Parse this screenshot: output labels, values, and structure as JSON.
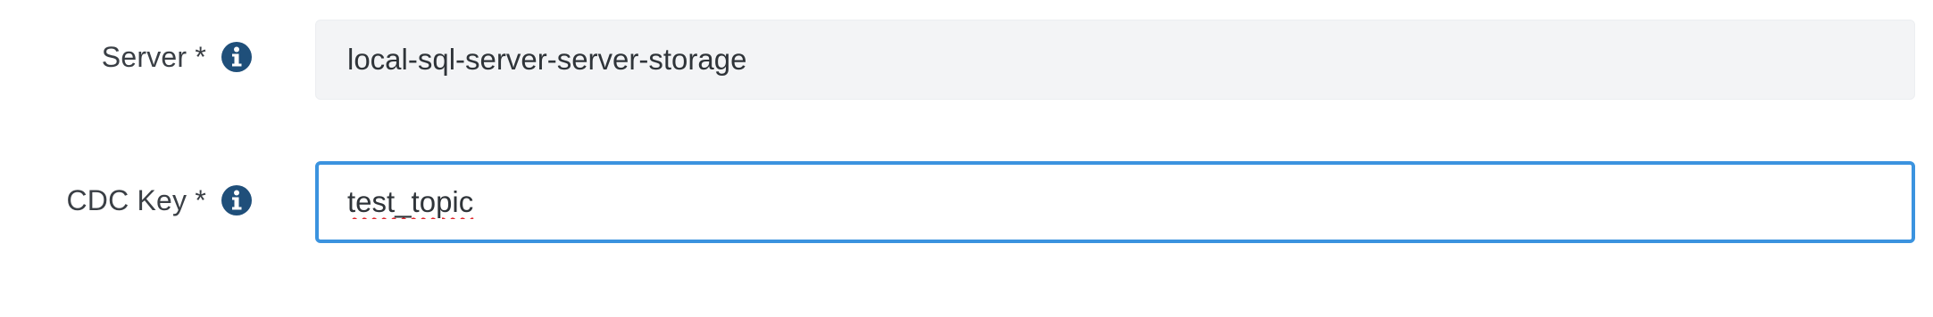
{
  "form": {
    "server": {
      "label": "Server *",
      "value": "local-sql-server-server-storage",
      "info_icon": "info-circle-icon"
    },
    "cdc_key": {
      "label": "CDC Key *",
      "value": "test_topic",
      "info_icon": "info-circle-icon"
    }
  },
  "colors": {
    "label_text": "#3a3f45",
    "icon": "#1f4f7a",
    "readonly_bg": "#f3f4f6",
    "focus_border": "#3b93df",
    "spellcheck_underline": "#e0282e"
  }
}
